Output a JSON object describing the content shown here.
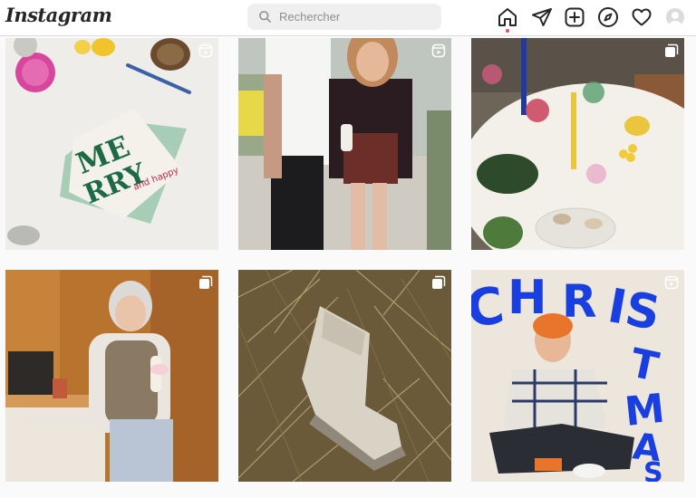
{
  "app": {
    "logo": "Instagram"
  },
  "search": {
    "placeholder": "Rechercher"
  },
  "nav": {
    "icons": [
      "home-icon",
      "direct-icon",
      "new-post-icon",
      "explore-icon",
      "activity-icon",
      "profile-avatar"
    ]
  },
  "posts": [
    {
      "name": "post-merry-christmas-cards",
      "card_text": "MERRY and happy",
      "badge": "reel-icon"
    },
    {
      "name": "post-couple-street",
      "badge": "reel-icon"
    },
    {
      "name": "post-festive-table",
      "badge": "carousel-icon"
    },
    {
      "name": "post-woman-kitchen",
      "badge": "carousel-icon"
    },
    {
      "name": "post-boot-grass",
      "badge": "carousel-icon"
    },
    {
      "name": "post-christmas-man",
      "poster_text": "CHRISTMAS",
      "badge": "reel-icon"
    }
  ],
  "colors": {
    "accent": "#ed4956",
    "poster_blue": "#1a3fe0"
  }
}
